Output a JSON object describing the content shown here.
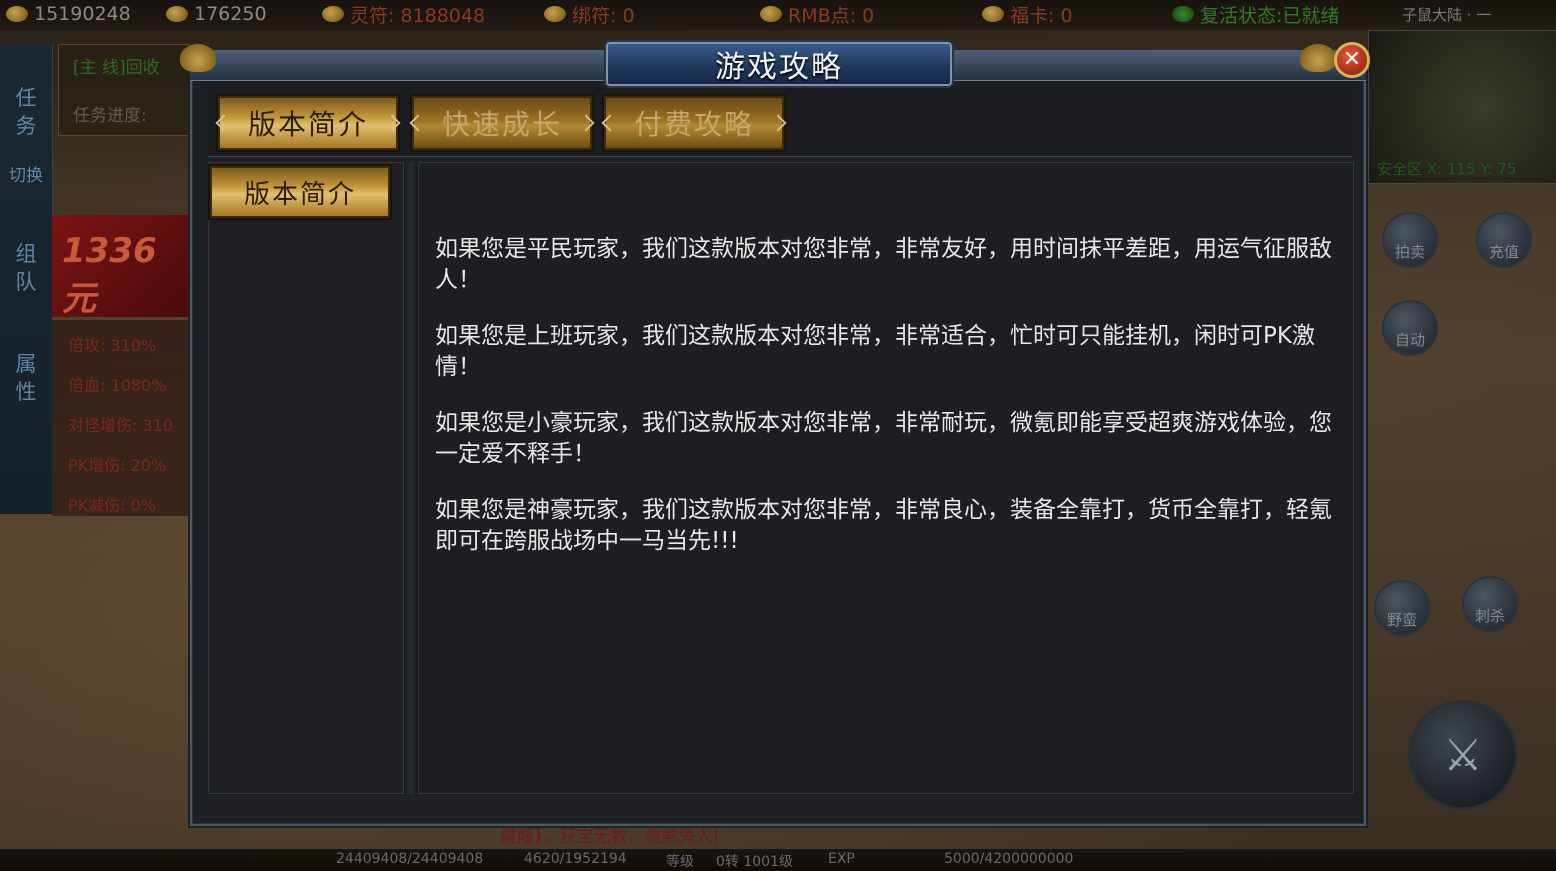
{
  "top_stats": {
    "gold": "15190248",
    "ingot": "176250",
    "lingfu": "灵符: 8188048",
    "bound_fu": "绑符: 0",
    "rmb": "RMB点: 0",
    "fuka": "福卡: 0",
    "revive": "复活状态:已就绪",
    "zone": "子鼠大陆 · 一"
  },
  "left_nav": {
    "quest": "任务",
    "switch": "切换",
    "team": "组队",
    "attr": "属性"
  },
  "quest": {
    "line": "[主 线]回收",
    "progress": "任务进度:"
  },
  "promo_text": "1336元",
  "attributes": [
    "倍攻: 310%",
    "倍血: 1080%",
    "对怪增伤: 310",
    "PK增伤: 20%",
    "PK减伤: 0%"
  ],
  "minimap": {
    "coords": "安全区 X: 115 Y: 75"
  },
  "right_buttons": {
    "auction": "拍卖",
    "recharge": "充值",
    "auto": "自动",
    "barbarian": "野蛮",
    "assassinate": "刺杀"
  },
  "bottom": {
    "hp": "24409408/24409408",
    "mp": "4620/1952194",
    "level_label": "等级",
    "level": "0转 1001级",
    "exp_label": "EXP",
    "exp": "5000/4200000000",
    "scroll": "魔龍】，获宝无数，袁煞旁人!"
  },
  "dialog": {
    "title": "游戏攻略",
    "close_label": "✕",
    "tabs": [
      "版本简介",
      "快速成长",
      "付费攻略"
    ],
    "active_tab_index": 0,
    "side_items": [
      "版本简介"
    ],
    "paragraphs": [
      "如果您是平民玩家，我们这款版本对您非常，非常友好，用时间抹平差距，用运气征服敌人！",
      "如果您是上班玩家，我们这款版本对您非常，非常适合，忙时可只能挂机，闲时可PK激情！",
      "如果您是小豪玩家，我们这款版本对您非常，非常耐玩，微氪即能享受超爽游戏体验，您一定爱不释手！",
      "如果您是神豪玩家，我们这款版本对您非常，非常良心，装备全靠打，货币全靠打，轻氪即可在跨服战场中一马当先!!!"
    ]
  },
  "colors": {
    "gold_tab": "#c99a3c",
    "dialog_bg": "#1d1f23",
    "title_blue": "#1f3658",
    "text": "#e8e8e8"
  }
}
